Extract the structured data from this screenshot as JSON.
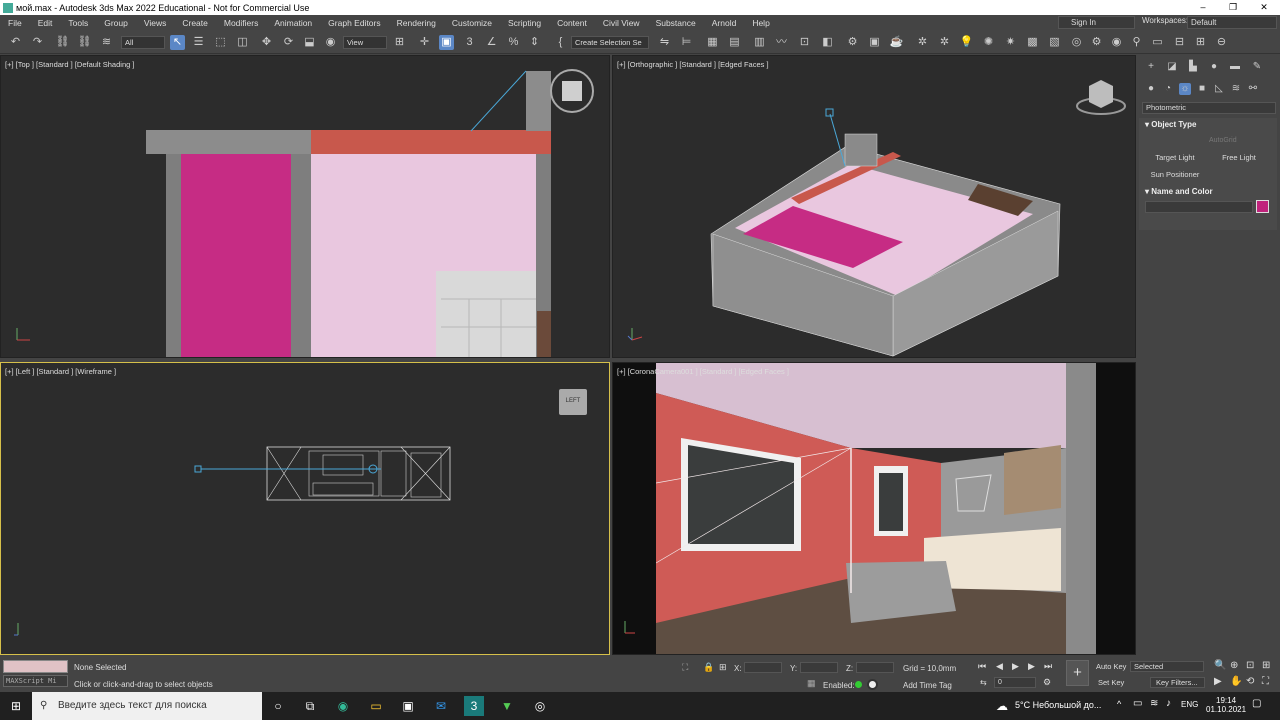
{
  "window": {
    "title": "мой.max - Autodesk 3ds Max 2022 Educational - Not for Commercial Use",
    "controls": [
      "–",
      "❐",
      "✕"
    ]
  },
  "menu": [
    "File",
    "Edit",
    "Tools",
    "Group",
    "Views",
    "Create",
    "Modifiers",
    "Animation",
    "Graph Editors",
    "Rendering",
    "Customize",
    "Scripting",
    "Content",
    "Civil View",
    "Substance",
    "Arnold",
    "Help"
  ],
  "account": {
    "sign_in": "Sign In",
    "workspaces_label": "Workspaces:",
    "workspace": "Default"
  },
  "toolbar": {
    "filter": "All",
    "ref_coord": "View",
    "selection_set": "Create Selection Se"
  },
  "viewports": {
    "top": {
      "label": "[+] [Top ] [Standard ] [Default Shading ]"
    },
    "ortho": {
      "label": "[+] [Orthographic ] [Standard ] [Edged Faces ]"
    },
    "left": {
      "label": "[+] [Left ] [Standard ] [Wireframe ]",
      "cube_label": "LEFT"
    },
    "camera": {
      "label": "[+] [CoronaCamera001 ] [Standard ] [Edged Faces ]"
    }
  },
  "command_panel": {
    "category": "Photometric",
    "object_type_title": "Object Type",
    "autogrid": "AutoGrid",
    "buttons": [
      "Target Light",
      "Free Light",
      "Sun Positioner"
    ],
    "name_color_title": "Name and Color",
    "color": "#c0237c"
  },
  "status": {
    "maxscript": "MAXScript Mi",
    "selection": "None Selected",
    "prompt": "Click or click-and-drag to select objects",
    "x_label": "X:",
    "y_label": "Y:",
    "z_label": "Z:",
    "grid": "Grid = 10,0mm",
    "enabled": "Enabled:",
    "add_time_tag": "Add Time Tag",
    "frame": "0",
    "auto_key": "Auto Key",
    "set_key": "Set Key",
    "selected": "Selected",
    "key_filters": "Key Filters..."
  },
  "taskbar": {
    "search_placeholder": "Введите здесь текст для поиска",
    "weather": "5°C  Небольшой до...",
    "lang": "ENG",
    "time": "19:14",
    "date": "01.10.2021"
  }
}
